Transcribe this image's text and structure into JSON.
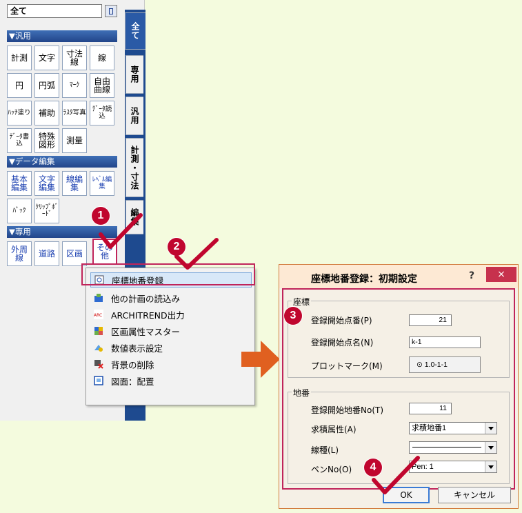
{
  "palette": {
    "title": "全て",
    "sections": [
      {
        "label": "▼汎用"
      },
      {
        "label": "▼データ編集"
      },
      {
        "label": "▼専用"
      }
    ],
    "tools_general": [
      {
        "label": "計測"
      },
      {
        "label": "文字"
      },
      {
        "label": "寸法線"
      },
      {
        "label": "線"
      },
      {
        "label": "円"
      },
      {
        "label": "円弧"
      },
      {
        "label": "ﾏｰｸ"
      },
      {
        "label": "自由曲線"
      },
      {
        "label": "ﾊｯﾁ塗り"
      },
      {
        "label": "補助"
      },
      {
        "label": "ﾗｽﾀ写真"
      },
      {
        "label": "ﾃﾞｰﾀ読込"
      },
      {
        "label": "ﾃﾞｰﾀ書込"
      },
      {
        "label": "特殊図形"
      },
      {
        "label": "測量"
      }
    ],
    "tools_data": [
      {
        "label": "基本編集"
      },
      {
        "label": "文字編集"
      },
      {
        "label": "線編集"
      },
      {
        "label": "ﾚﾍﾞﾙ編集"
      },
      {
        "label": "ﾊﾟｯｸ"
      },
      {
        "label": "ｸﾘｯﾌﾟﾎﾞｰﾄﾞ"
      }
    ],
    "tools_special": [
      {
        "label": "外周線"
      },
      {
        "label": "道路"
      },
      {
        "label": "区画"
      },
      {
        "label": "その他"
      }
    ],
    "tabs": [
      {
        "label": "全て"
      },
      {
        "label": "専用"
      },
      {
        "label": "汎用"
      },
      {
        "label": "計測・寸法"
      },
      {
        "label": "編集"
      }
    ]
  },
  "markers": {
    "m1": "1",
    "m2": "2",
    "m3": "3",
    "m4": "4"
  },
  "menu": {
    "items": [
      {
        "label": "座標地番登録",
        "icon": "coordinate-register-icon"
      },
      {
        "label": "他の計画の読込み",
        "icon": "plan-import-icon"
      },
      {
        "label": "ARCHITREND出力",
        "icon": "architrend-icon"
      },
      {
        "label": "区画属性マスター",
        "icon": "lot-attribute-icon"
      },
      {
        "label": "数値表示設定",
        "icon": "numeric-display-icon"
      },
      {
        "label": "背景の削除",
        "icon": "background-delete-icon"
      },
      {
        "label": "図面：配置",
        "icon": "drawing-layout-icon"
      }
    ]
  },
  "dialog": {
    "title": "座標地番登録：初期設定",
    "help": "?",
    "close": "×",
    "coord_group": "座標",
    "start_point_no_label": "登録開始点番(P)",
    "start_point_no": "21",
    "start_point_name_label": "登録開始点名(N)",
    "start_point_name": "k-1",
    "plot_mark_label": "プロットマーク(M)",
    "plot_mark": "⊙ 1.0-1-1",
    "lot_group": "地番",
    "start_lot_no_label": "登録開始地番No(T)",
    "start_lot_no": "11",
    "area_attr_label": "求積属性(A)",
    "area_attr": "求積地番1",
    "line_type_label": "線種(L)",
    "pen_no_label": "ペンNo(O)",
    "pen_no": "Pen: 1",
    "ok": "OK",
    "cancel": "キャンセル"
  },
  "colors": {
    "background": "#f4fbde",
    "accent_red": "#c0062e",
    "palette_blue": "#22458a",
    "arrow_orange": "#e06020"
  }
}
